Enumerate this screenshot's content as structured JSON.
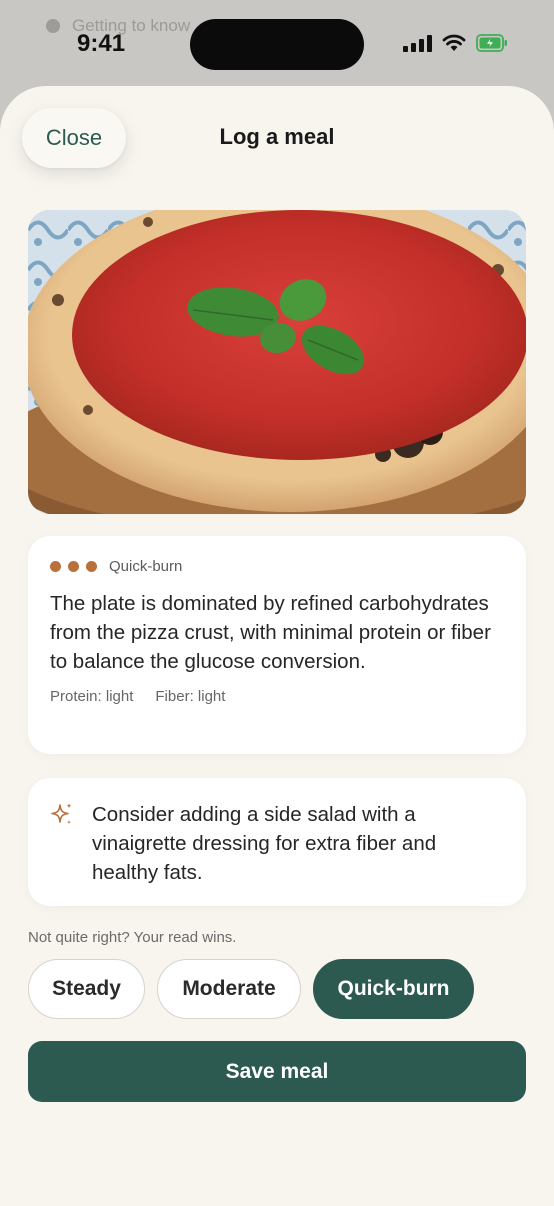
{
  "background_app": {
    "label": "Getting to know"
  },
  "status_bar": {
    "time": "9:41"
  },
  "sheet": {
    "close_label": "Close",
    "title": "Log a meal"
  },
  "analysis": {
    "rating_dots": 3,
    "rating_label": "Quick-burn",
    "text": "The plate is dominated by refined carbohydrates from the pizza crust, with minimal protein or fiber to balance the glucose conversion.",
    "protein": "Protein: light",
    "fiber": "Fiber: light"
  },
  "tip": {
    "icon": "sparkle-icon",
    "text": "Consider adding a side salad with a vinaigrette dressing for extra fiber and healthy fats."
  },
  "override": {
    "hint": "Not quite right? Your read wins.",
    "options": [
      "Steady",
      "Moderate",
      "Quick-burn"
    ],
    "selected": "Quick-burn"
  },
  "save_label": "Save meal",
  "colors": {
    "accent": "#2d5a50",
    "rating_dot": "#b8703c",
    "sheet_bg": "#f8f5ef"
  }
}
